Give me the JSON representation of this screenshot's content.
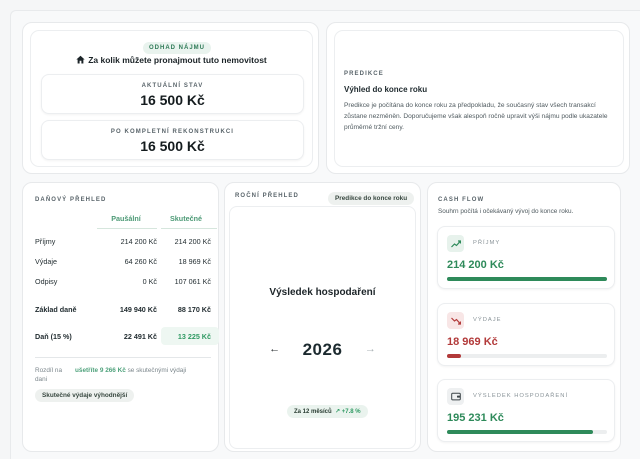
{
  "rental": {
    "badge": "ODHAD NÁJMU",
    "title": "Za kolik můžete pronajmout tuto nemovitost",
    "current_label": "AKTUÁLNÍ STAV",
    "current_value": "16 500 Kč",
    "renovated_label": "PO KOMPLETNÍ REKONSTRUKCI",
    "renovated_value": "16 500 Kč"
  },
  "prediction": {
    "eyebrow": "PREDIKCE",
    "title": "Výhled do konce roku",
    "text": "Predikce je počítána do konce roku za předpokladu, že současný stav všech transakcí zůstane nezměněn. Doporučujeme však alespoň ročně upravit výši nájmu podle ukazatele průměrné tržní ceny."
  },
  "tax": {
    "eyebrow": "DAŇOVÝ PŘEHLED",
    "col_flat": "Paušální",
    "col_actual": "Skutečné",
    "rows": [
      {
        "label": "Příjmy",
        "flat": "214 200 Kč",
        "actual": "214 200 Kč"
      },
      {
        "label": "Výdaje",
        "flat": "64 260 Kč",
        "actual": "18 969 Kč"
      },
      {
        "label": "Odpisy",
        "flat": "0 Kč",
        "actual": "107 061 Kč"
      },
      {
        "label": "Základ daně",
        "flat": "149 940 Kč",
        "actual": "88 170 Kč"
      },
      {
        "label": "Daň (15 %)",
        "flat": "22 491 Kč",
        "actual": "13 225 Kč"
      }
    ],
    "saving_label": "Rozdíl na dani",
    "saving_amount": "ušetříte 9 266 Kč",
    "saving_rest": " se skutečnými výdaji",
    "pill": "Skutečné výdaje výhodnější"
  },
  "annual": {
    "eyebrow": "ROČNÍ PŘEHLED",
    "pill": "Predikce do konce roku",
    "result_title": "Výsledek hospodaření",
    "year": "2026",
    "prev": "←",
    "next": "→",
    "period": "Za 12 měsíců",
    "delta": "+7.8 %"
  },
  "cashflow": {
    "eyebrow": "CASH FLOW",
    "subtitle": "Souhrn počítá i očekávaný vývoj do konce roku.",
    "items": [
      {
        "label": "PŘÍJMY",
        "value": "214 200 Kč",
        "icon": "trend-up-icon",
        "fill": 1.0,
        "color": "#2e8a5a"
      },
      {
        "label": "VÝDAJE",
        "value": "18 969 Kč",
        "icon": "trend-down-icon",
        "fill": 0.09,
        "color": "#b23a3a"
      },
      {
        "label": "VÝSLEDEK HOSPODAŘENÍ",
        "value": "195 231 Kč",
        "icon": "wallet-icon",
        "fill": 0.91,
        "color": "#2e8a5a"
      }
    ]
  },
  "colors": {
    "accent_green": "#2e8a5a",
    "accent_red": "#b23a3a"
  }
}
